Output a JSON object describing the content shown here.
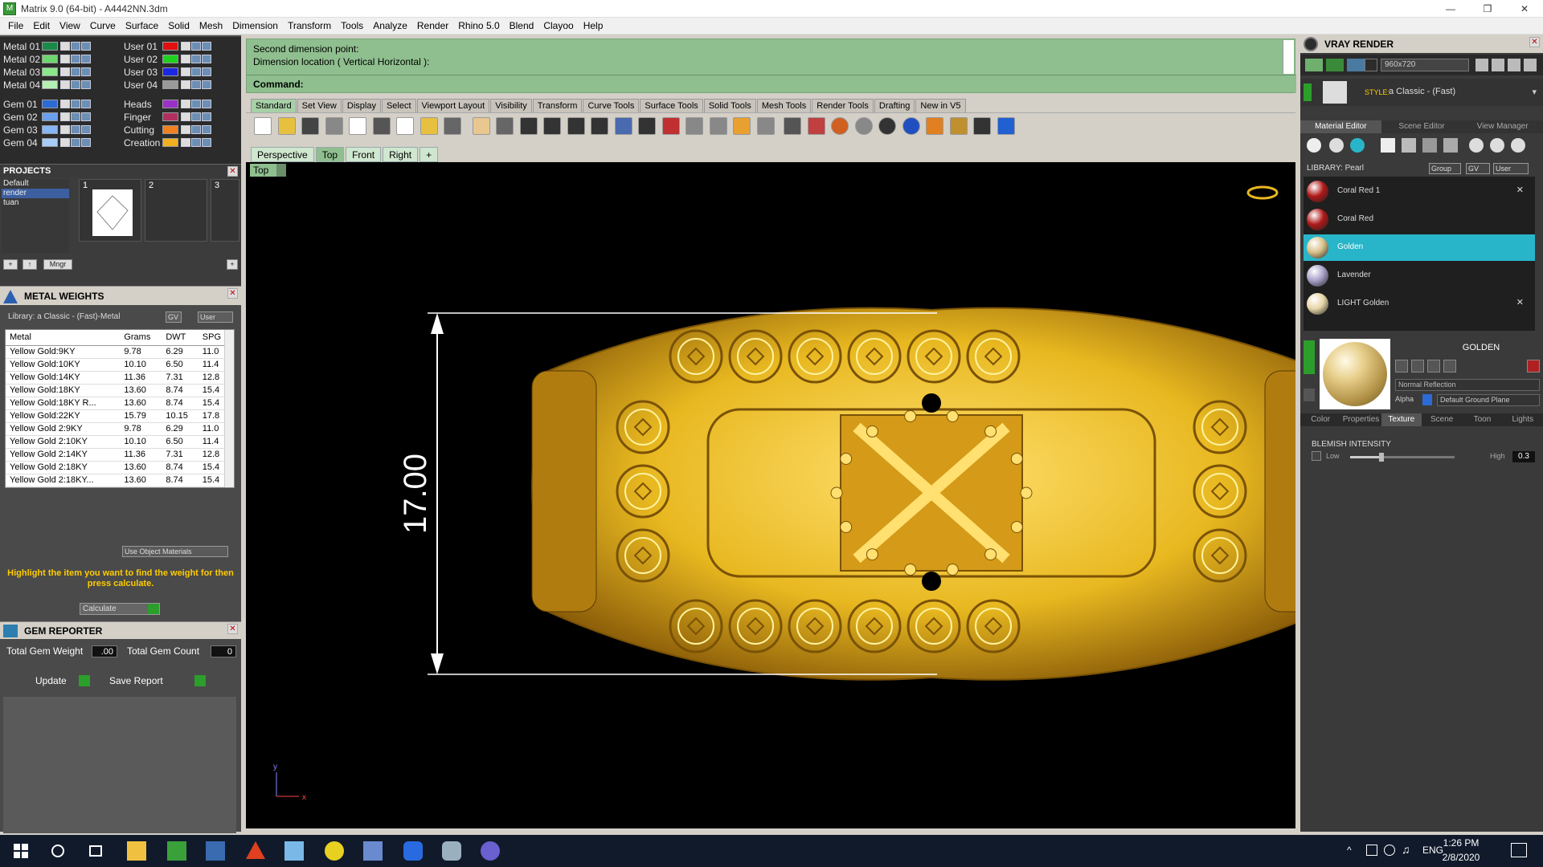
{
  "window": {
    "title": "Matrix 9.0 (64-bit) - A4442NN.3dm"
  },
  "menu": [
    "File",
    "Edit",
    "View",
    "Curve",
    "Surface",
    "Solid",
    "Mesh",
    "Dimension",
    "Transform",
    "Tools",
    "Analyze",
    "Render",
    "Rhino 5.0",
    "Blend",
    "Clayoo",
    "Help"
  ],
  "layers": {
    "left": [
      {
        "name": "Metal 01",
        "color": "#1a8a4a"
      },
      {
        "name": "Metal 02",
        "color": "#6fd66f"
      },
      {
        "name": "Metal 03",
        "color": "#8ae88a"
      },
      {
        "name": "Metal 04",
        "color": "#b4f0b4"
      },
      {
        "name": "Gem 01",
        "color": "#2c6ad6"
      },
      {
        "name": "Gem 02",
        "color": "#6aa0ee"
      },
      {
        "name": "Gem 03",
        "color": "#86b6f4"
      },
      {
        "name": "Gem 04",
        "color": "#a8ccf8"
      }
    ],
    "right": [
      {
        "name": "User 01",
        "color": "#e01010"
      },
      {
        "name": "User 02",
        "color": "#20d020"
      },
      {
        "name": "User 03",
        "color": "#1c28e0"
      },
      {
        "name": "User 04",
        "color": "#9a9a9a"
      },
      {
        "name": "Heads",
        "color": "#9b30c8"
      },
      {
        "name": "Finger",
        "color": "#b03060"
      },
      {
        "name": "Cutting",
        "color": "#f08020"
      },
      {
        "name": "Creation",
        "color": "#f0b020"
      }
    ]
  },
  "projects": {
    "title": "PROJECTS",
    "list": [
      "Default",
      "render",
      "tuan"
    ],
    "selected": "render",
    "slots": [
      "1",
      "2",
      "3"
    ],
    "mngr_label": "Mngr"
  },
  "metal_weights": {
    "title": "METAL WEIGHTS",
    "library": "Library: a Classic - (Fast)-Metal",
    "gv_label": "GV",
    "user_label": "User",
    "columns": [
      "Metal",
      "Grams",
      "DWT",
      "SPG"
    ],
    "rows": [
      [
        "Yellow Gold:9KY",
        "9.78",
        "6.29",
        "11.0"
      ],
      [
        "Yellow Gold:10KY",
        "10.10",
        "6.50",
        "11.4"
      ],
      [
        "Yellow Gold:14KY",
        "11.36",
        "7.31",
        "12.8"
      ],
      [
        "Yellow Gold:18KY",
        "13.60",
        "8.74",
        "15.4"
      ],
      [
        "Yellow Gold:18KY R...",
        "13.60",
        "8.74",
        "15.4"
      ],
      [
        "Yellow Gold:22KY",
        "15.79",
        "10.15",
        "17.8"
      ],
      [
        "Yellow Gold 2:9KY",
        "9.78",
        "6.29",
        "11.0"
      ],
      [
        "Yellow Gold 2:10KY",
        "10.10",
        "6.50",
        "11.4"
      ],
      [
        "Yellow Gold 2:14KY",
        "11.36",
        "7.31",
        "12.8"
      ],
      [
        "Yellow Gold 2:18KY",
        "13.60",
        "8.74",
        "15.4"
      ],
      [
        "Yellow Gold 2:18KY...",
        "13.60",
        "8.74",
        "15.4"
      ]
    ],
    "use_object_materials": "Use Object Materials",
    "hint": "Highlight the item you want to find the weight for then press calculate.",
    "calculate": "Calculate"
  },
  "gem_reporter": {
    "title": "GEM REPORTER",
    "total_weight_label": "Total Gem Weight",
    "total_weight": ".00",
    "total_count_label": "Total Gem Count",
    "total_count": "0",
    "update": "Update",
    "save_report": "Save Report"
  },
  "command": {
    "line1": "Second dimension point:",
    "line2": "Dimension location ( Vertical  Horizontal ):",
    "prompt": "Command:"
  },
  "toolbar_tabs": [
    "Standard",
    "Set View",
    "Display",
    "Select",
    "Viewport Layout",
    "Visibility",
    "Transform",
    "Curve Tools",
    "Surface Tools",
    "Solid Tools",
    "Mesh Tools",
    "Render Tools",
    "Drafting",
    "New in V5"
  ],
  "toolbar_active": "Standard",
  "viewport_tabs": [
    "Perspective",
    "Top",
    "Front",
    "Right",
    "+"
  ],
  "viewport_active": "Top",
  "viewport": {
    "label": "Top",
    "dimension": "17.00",
    "axis_x": "x",
    "axis_y": "y",
    "bg": "#000000",
    "gold": "#e8b820"
  },
  "vray": {
    "title": "VRAY RENDER",
    "resolution": "960x720",
    "style_label": "STYLE:",
    "style_value": "a Classic - (Fast)",
    "tabs": [
      "Material Editor",
      "Scene Editor",
      "View Manager"
    ],
    "active_tab": "Material Editor",
    "library": "LIBRARY: Pearl",
    "group_label": "Group",
    "gv_label": "GV",
    "user_label": "User",
    "materials": [
      {
        "name": "Coral Red 1",
        "color": "#b01818",
        "removable": true
      },
      {
        "name": "Coral Red",
        "color": "#b01818",
        "removable": false
      },
      {
        "name": "Golden",
        "color": "#d8c088",
        "removable": false
      },
      {
        "name": "Lavender",
        "color": "#a8a0c8",
        "removable": false
      },
      {
        "name": "LIGHT Golden",
        "color": "#e6d6a8",
        "removable": true
      }
    ],
    "selected_material": "Golden",
    "material_name": "GOLDEN",
    "reflection": "Normal Reflection",
    "alpha_label": "Alpha",
    "ground": "Default Ground Plane",
    "subtabs": [
      "Color",
      "Properties",
      "Texture",
      "Scene",
      "Toon",
      "Lights"
    ],
    "active_subtab": "Texture",
    "blemish_title": "BLEMISH INTENSITY",
    "blemish_low": "Low",
    "blemish_high": "High",
    "blemish_value": "0.3",
    "blemish_level": 0.3
  },
  "taskbar": {
    "time": "1:26 PM",
    "date": "2/8/2020",
    "lang": "ENG"
  }
}
